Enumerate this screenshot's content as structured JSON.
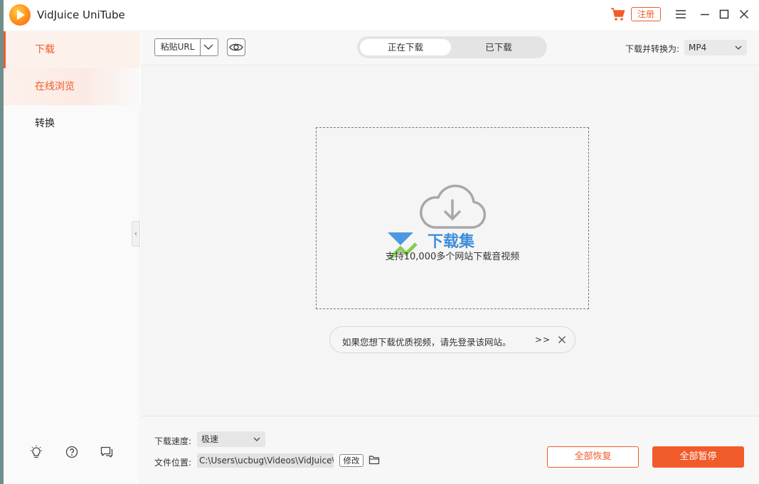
{
  "app": {
    "title": "VidJuice UniTube",
    "register_label": "注册"
  },
  "sidebar": {
    "items": [
      {
        "label": "下载"
      },
      {
        "label": "在线浏览"
      },
      {
        "label": "转换"
      }
    ]
  },
  "toolbar": {
    "paste_label": "粘贴URL",
    "tabs": [
      {
        "label": "正在下载"
      },
      {
        "label": "已下载"
      }
    ],
    "convert_label": "下载并转换为:",
    "format_value": "MP4"
  },
  "drop_zone": {
    "text": "支持10,000多个网站下载音视频",
    "watermark": "下载集"
  },
  "hint": {
    "text": "如果您想下载优质视频，请先登录该网站。",
    "more": ">>"
  },
  "footer": {
    "speed_label": "下载速度:",
    "speed_value": "极速",
    "location_label": "文件位置:",
    "location_path": "C:\\Users\\ucbug\\Videos\\VidJuice\\",
    "modify_label": "修改",
    "resume_all_label": "全部恢复",
    "pause_all_label": "全部暂停"
  },
  "colors": {
    "accent": "#f15a2a",
    "active_bg": "#fdf1eb"
  }
}
